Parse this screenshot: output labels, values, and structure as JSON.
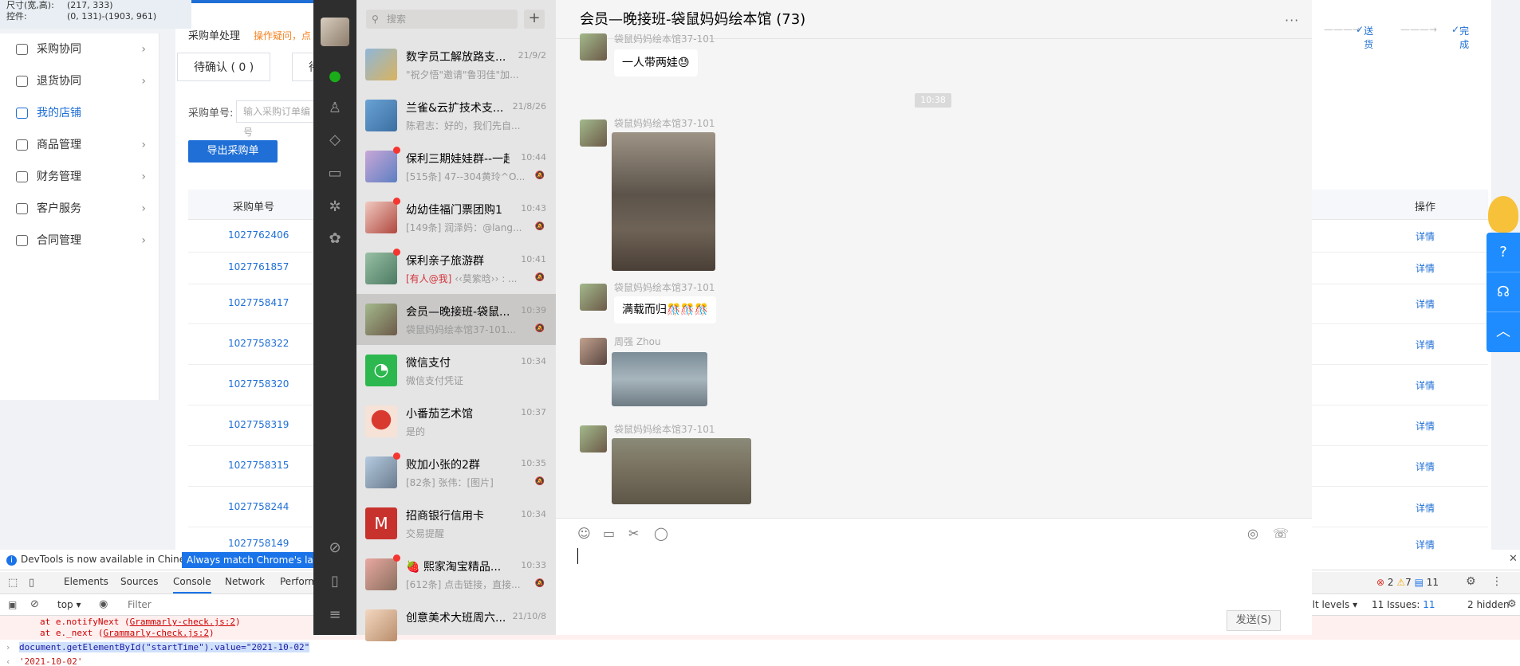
{
  "inspector": {
    "size_label": "尺寸(宽,高):",
    "size_value": "(217, 333)",
    "control_label": "控件:",
    "control_value": "(0, 131)-(1903, 961)"
  },
  "sidebar": {
    "items": [
      {
        "label": "采购协同",
        "icon": "cart-icon"
      },
      {
        "label": "退货协同",
        "icon": "return-icon"
      },
      {
        "label": "我的店铺",
        "icon": "shop-icon"
      },
      {
        "label": "商品管理",
        "icon": "box-icon"
      },
      {
        "label": "财务管理",
        "icon": "yen-icon"
      },
      {
        "label": "客户服务",
        "icon": "heart-icon"
      },
      {
        "label": "合同管理",
        "icon": "contract-icon"
      }
    ]
  },
  "purchase": {
    "title": "采购单处理",
    "hint": "操作疑问，点",
    "tabs": [
      "待确认 ( 0 )",
      "待"
    ],
    "order_label": "采购单号:",
    "order_placeholder": "输入采购订单编号",
    "export_label": "导出采购单",
    "col_order": "采购单号",
    "col_op": "操作",
    "orders": [
      "1027762406",
      "1027761857",
      "1027758417",
      "1027758322",
      "1027758320",
      "1027758319",
      "1027758315",
      "1027758244",
      "1027758149"
    ],
    "detail_label": "详情",
    "steps": [
      "送货",
      "完成"
    ]
  },
  "devtools": {
    "notice": "DevTools is now available in Chinese!",
    "match_button": "Always match Chrome's langu",
    "tabs": [
      "Elements",
      "Sources",
      "Console",
      "Network",
      "Perform"
    ],
    "context": "top",
    "filter_placeholder": "Filter",
    "error_lines": [
      {
        "prefix": "at e.notifyNext (",
        "file": "Grammarly-check.js:2",
        "suffix": ")"
      },
      {
        "prefix": "at e._next (",
        "file": "Grammarly-check.js:2",
        "suffix": ")"
      }
    ],
    "command": "document.getElementById(\"startTime\").value=\"2021-10-02\"",
    "result": "'2021-10-02'",
    "levels": "ult levels",
    "issues": "11 Issues:",
    "issues_count": "11",
    "hidden": "2 hidden",
    "err_count": "2",
    "warn_count": "7",
    "info_count": "11"
  },
  "wechat": {
    "search_placeholder": "搜索",
    "chats": [
      {
        "name": "数字员工解放路支...",
        "time": "21/9/2",
        "preview": "\"祝夕悟\"邀请\"鲁羽佳\"加...",
        "unread": false,
        "muted": false
      },
      {
        "name": "兰雀&云扩技术支...",
        "time": "21/8/26",
        "preview": "陈君志：好的，我们先自...",
        "unread": false,
        "muted": false
      },
      {
        "name": "保利三期娃娃群--一起...",
        "time": "10:44",
        "preview": "[515条] 47--304黄玲^O...",
        "unread": true,
        "muted": true
      },
      {
        "name": "幼幼佳福门票团购1",
        "time": "10:43",
        "preview": "[149条] 润泽妈：@lang...",
        "unread": true,
        "muted": true
      },
      {
        "name": "保利亲子旅游群",
        "time": "10:41",
        "preview_red": "[有人@我]",
        "preview": " ‹‹莫紫晗›› : ...",
        "unread": true,
        "muted": true
      },
      {
        "name": "会员—晚接班-袋鼠...",
        "time": "10:39",
        "preview": "袋鼠妈妈绘本馆37-101...",
        "unread": false,
        "muted": true,
        "selected": true
      },
      {
        "name": "微信支付",
        "time": "10:34",
        "preview": "微信支付凭证",
        "unread": false,
        "muted": false
      },
      {
        "name": "小番茄艺术馆",
        "time": "10:37",
        "preview": "是的",
        "unread": false,
        "muted": false
      },
      {
        "name": "败加小张的2群",
        "time": "10:35",
        "preview": "[82条] 张伟：[图片]",
        "unread": true,
        "muted": true
      },
      {
        "name": "招商银行信用卡",
        "time": "10:34",
        "preview": "交易提醒",
        "unread": false,
        "muted": false
      },
      {
        "name": "🍓 熙家淘宝精品...",
        "time": "10:33",
        "preview": "[612条] 点击链接，直接...",
        "unread": true,
        "muted": true
      },
      {
        "name": "创意美术大班周六...",
        "time": "21/10/8",
        "preview": "",
        "unread": false,
        "muted": false
      }
    ],
    "chat_title": "会员—晚接班-袋鼠妈妈绘本馆 (73)",
    "time_divider": "10:38",
    "messages": [
      {
        "sender": "袋鼠妈妈绘本馆37-101",
        "text": "一人带两娃😓"
      },
      {
        "sender": "袋鼠妈妈绘本馆37-101",
        "image": "photo"
      },
      {
        "sender": "袋鼠妈妈绘本馆37-101",
        "text": "满载而归🎊🎊🎊"
      },
      {
        "sender": "周强 Zhou",
        "image": "photo"
      },
      {
        "sender": "袋鼠妈妈绘本馆37-101",
        "image": "photo"
      }
    ],
    "send_label": "发送(S)"
  }
}
